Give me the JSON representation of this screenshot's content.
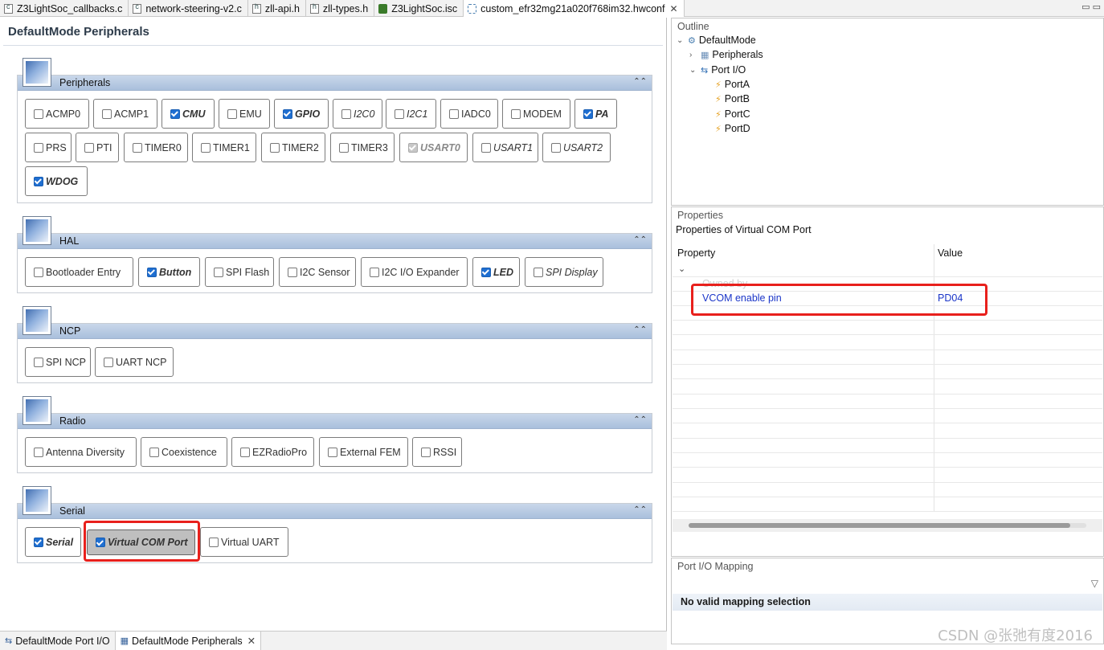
{
  "tabs": [
    {
      "label": "Z3LightSoc_callbacks.c",
      "icon": "c-file-icon"
    },
    {
      "label": "network-steering-v2.c",
      "icon": "c-file-icon"
    },
    {
      "label": "zll-api.h",
      "icon": "h-file-icon"
    },
    {
      "label": "zll-types.h",
      "icon": "h-file-icon"
    },
    {
      "label": "Z3LightSoc.isc",
      "icon": "isc-file-icon"
    },
    {
      "label": "custom_efr32mg21a020f768im32.hwconf",
      "icon": "hwconf-file-icon",
      "active": true
    }
  ],
  "editor": {
    "title": "DefaultMode Peripherals",
    "sections": [
      {
        "title": "Peripherals",
        "items": [
          {
            "label": "ACMP0",
            "state": "off"
          },
          {
            "label": "ACMP1",
            "state": "off"
          },
          {
            "label": "CMU",
            "state": "on"
          },
          {
            "label": "EMU",
            "state": "off"
          },
          {
            "label": "GPIO",
            "state": "on"
          },
          {
            "label": "I2C0",
            "state": "off-italic"
          },
          {
            "label": "I2C1",
            "state": "off-italic"
          },
          {
            "label": "IADC0",
            "state": "off"
          },
          {
            "label": "MODEM",
            "state": "off"
          },
          {
            "label": "PA",
            "state": "on"
          },
          {
            "label": "PRS",
            "state": "off"
          },
          {
            "label": "PTI",
            "state": "off"
          },
          {
            "label": "TIMER0",
            "state": "off"
          },
          {
            "label": "TIMER1",
            "state": "off"
          },
          {
            "label": "TIMER2",
            "state": "off"
          },
          {
            "label": "TIMER3",
            "state": "off"
          },
          {
            "label": "USART0",
            "state": "disabled-checked"
          },
          {
            "label": "USART1",
            "state": "off-italic"
          },
          {
            "label": "USART2",
            "state": "off-italic"
          },
          {
            "label": "WDOG",
            "state": "on"
          }
        ]
      },
      {
        "title": "HAL",
        "items": [
          {
            "label": "Bootloader Entry",
            "state": "off"
          },
          {
            "label": "Button",
            "state": "on"
          },
          {
            "label": "SPI Flash",
            "state": "off"
          },
          {
            "label": "I2C Sensor",
            "state": "off"
          },
          {
            "label": "I2C I/O Expander",
            "state": "off"
          },
          {
            "label": "LED",
            "state": "on"
          },
          {
            "label": "SPI Display",
            "state": "off-italic"
          }
        ]
      },
      {
        "title": "NCP",
        "items": [
          {
            "label": "SPI NCP",
            "state": "off"
          },
          {
            "label": "UART NCP",
            "state": "off"
          }
        ]
      },
      {
        "title": "Radio",
        "items": [
          {
            "label": "Antenna Diversity",
            "state": "off"
          },
          {
            "label": "Coexistence",
            "state": "off"
          },
          {
            "label": "EZRadioPro",
            "state": "off"
          },
          {
            "label": "External FEM",
            "state": "off"
          },
          {
            "label": "RSSI",
            "state": "off"
          }
        ]
      },
      {
        "title": "Serial",
        "items": [
          {
            "label": "Serial",
            "state": "on"
          },
          {
            "label": "Virtual COM Port",
            "state": "on-selected"
          },
          {
            "label": "Virtual UART",
            "state": "off"
          }
        ]
      }
    ]
  },
  "bottom_tabs": [
    {
      "label": "DefaultMode Port I/O",
      "active": false
    },
    {
      "label": "DefaultMode Peripherals",
      "active": true
    }
  ],
  "outline": {
    "label": "Outline",
    "root": "DefaultMode",
    "peripherals": "Peripherals",
    "port_io": "Port I/O",
    "ports": [
      "PortA",
      "PortB",
      "PortC",
      "PortD"
    ]
  },
  "properties": {
    "label": "Properties",
    "subtitle": "Properties of Virtual COM Port",
    "col_property": "Property",
    "col_value": "Value",
    "group": "Owned by",
    "rows": [
      {
        "property": "VCOM enable pin",
        "value": "PD04"
      }
    ]
  },
  "port_mapping": {
    "label": "Port I/O Mapping",
    "message": "No valid mapping selection"
  },
  "watermark": "CSDN @张弛有度2016"
}
